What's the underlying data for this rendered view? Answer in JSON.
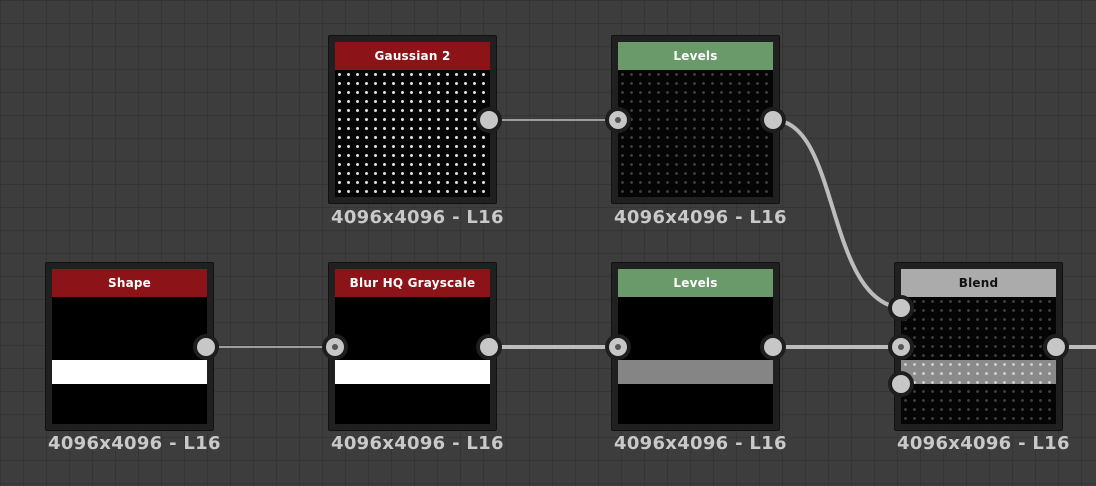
{
  "nodes": [
    {
      "id": "gaussian2",
      "title": "Gaussian 2",
      "label": "4096x4096 - L16"
    },
    {
      "id": "levels_top",
      "title": "Levels",
      "label": "4096x4096 - L16"
    },
    {
      "id": "shape",
      "title": "Shape",
      "label": "4096x4096 - L16"
    },
    {
      "id": "blurhq",
      "title": "Blur HQ Grayscale",
      "label": "4096x4096 - L16"
    },
    {
      "id": "levels_bottom",
      "title": "Levels",
      "label": "4096x4096 - L16"
    },
    {
      "id": "blend",
      "title": "Blend",
      "label": "4096x4096 - L16"
    }
  ],
  "colors": {
    "background": "#3d3d3d",
    "title_red": "#8c1418",
    "title_green": "#6a9a6a",
    "title_gray": "#ababab",
    "wire": "#bdbdbd"
  }
}
